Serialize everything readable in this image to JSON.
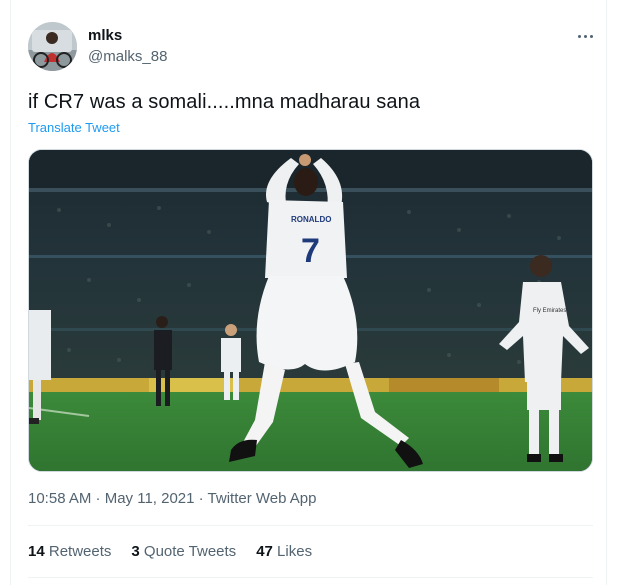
{
  "tweet": {
    "author": {
      "display_name": "mlks",
      "handle": "@malks_88"
    },
    "text": "if CR7 was a somali.....mna madharau sana",
    "translate_label": "Translate Tweet",
    "timestamp": "10:58 AM · May 11, 2021 · Twitter Web App",
    "stats": [
      {
        "count": "14",
        "label": "Retweets"
      },
      {
        "count": "3",
        "label": "Quote Tweets"
      },
      {
        "count": "47",
        "label": "Likes"
      }
    ]
  },
  "icons": {
    "more": "more-dots-icon"
  },
  "colors": {
    "text_primary": "#0f1419",
    "text_secondary": "#536471",
    "link": "#1d9bf0",
    "border": "#eff3f4"
  }
}
